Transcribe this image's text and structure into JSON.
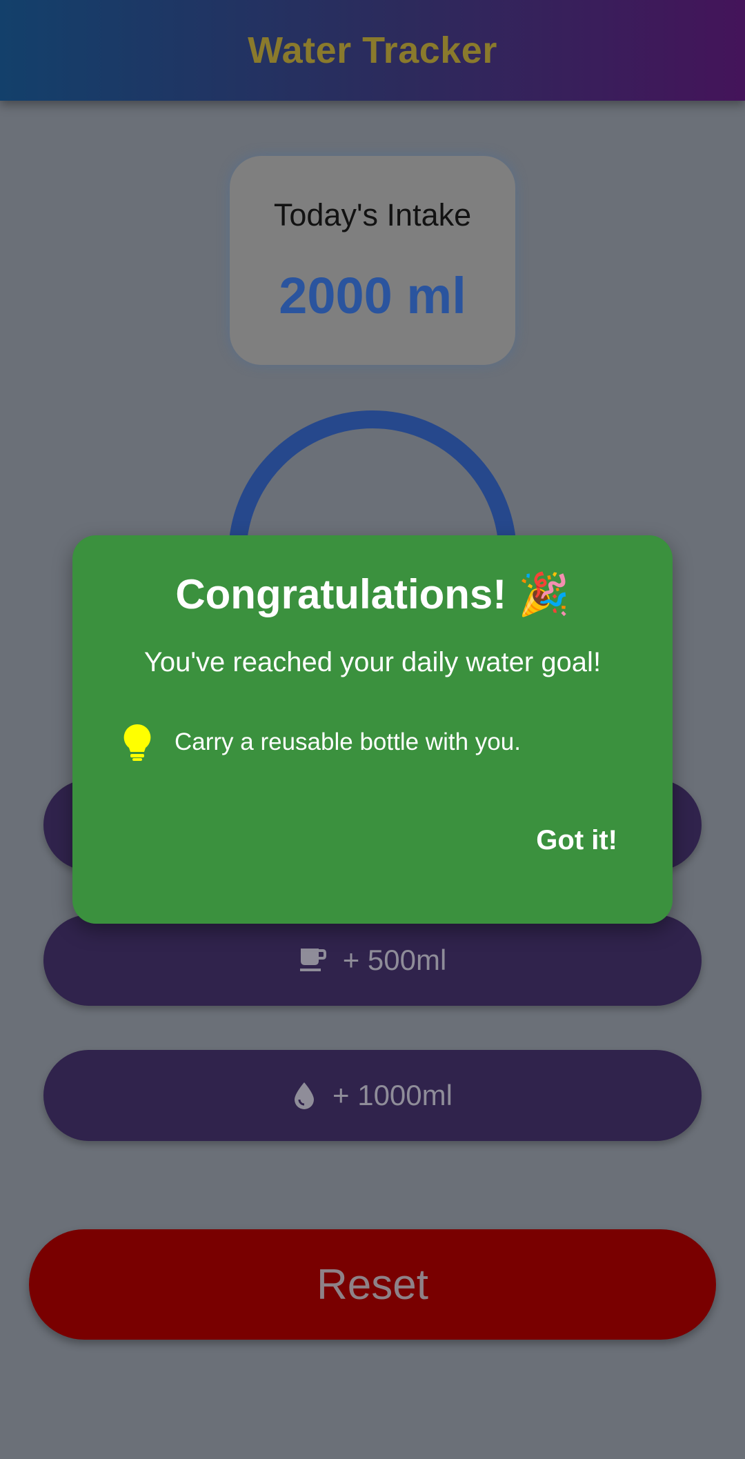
{
  "app": {
    "title": "Water Tracker"
  },
  "intake": {
    "label": "Today's Intake",
    "value": "2000 ml"
  },
  "progress": {
    "fraction": 1.0
  },
  "buttons": {
    "add_500": {
      "label": "+ 500ml",
      "icon": "coffee-cup-icon"
    },
    "add_1000": {
      "label": "+ 1000ml",
      "icon": "water-drop-icon"
    },
    "reset": {
      "label": "Reset"
    }
  },
  "dialog": {
    "title": "Congratulations! 🎉",
    "message": "You've reached your daily water goal!",
    "tip": {
      "icon": "lightbulb-icon",
      "text": "Carry a reusable bottle with you."
    },
    "confirm_label": "Got it!"
  },
  "colors": {
    "dialog_bg": "#3b913e",
    "accent_blue": "#2a549e",
    "button_bg": "#30234c",
    "reset_bg": "#790000",
    "tip_icon": "#ffff00"
  }
}
